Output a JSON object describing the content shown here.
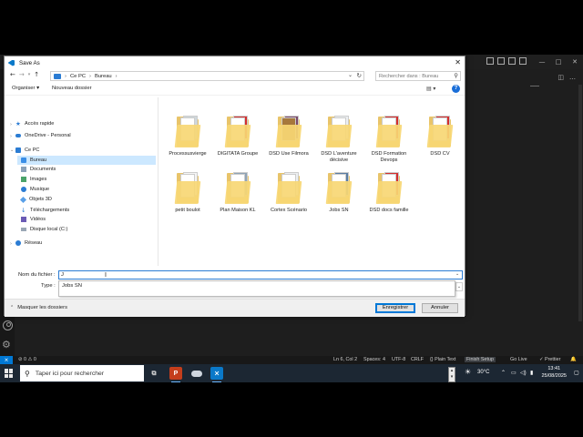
{
  "dialog": {
    "title": "Save As",
    "breadcrumb": [
      "Ce PC",
      "Bureau"
    ],
    "search_placeholder": "Rechercher dans : Bureau",
    "toolbar": {
      "organize": "Organiser ▾",
      "new_folder": "Nouveau dossier"
    },
    "sidebar": [
      {
        "label": "Accès rapide",
        "icon": "star-icon"
      },
      {
        "label": "OneDrive - Personal",
        "icon": "cloud-icon"
      },
      {
        "label": "Ce PC",
        "icon": "pc-icon"
      },
      {
        "label": "Bureau",
        "icon": "desktop-folder-icon",
        "selected": true
      },
      {
        "label": "Documents",
        "icon": "documents-icon"
      },
      {
        "label": "Images",
        "icon": "images-icon"
      },
      {
        "label": "Musique",
        "icon": "music-icon"
      },
      {
        "label": "Objets 3D",
        "icon": "objects-3d-icon"
      },
      {
        "label": "Téléchargements",
        "icon": "downloads-icon"
      },
      {
        "label": "Vidéos",
        "icon": "videos-icon"
      },
      {
        "label": "Disque local (C:)",
        "icon": "disk-icon"
      },
      {
        "label": "Réseau",
        "icon": "network-icon"
      }
    ],
    "files": [
      "Processusvierge",
      "DIGITATA Groupe",
      "DSD Use Filmora",
      "DSD L'aventure décisive",
      "DSD Formation Devops",
      "DSD CV",
      "petit boulot",
      "Plan Maison KL",
      "Cortex Scénario",
      "Jobs SN",
      "DSD docs famille"
    ],
    "filename_label": "Nom du fichier :",
    "filename_value": "J",
    "type_label": "Type :",
    "suggestion": "Jobs SN",
    "hide_folders": "Masquer les dossiers",
    "save_button": "Enregistrer",
    "cancel_button": "Annuler"
  },
  "statusbar": {
    "problems": "⊘ 0 ⚠ 0",
    "position": "Ln 6, Col 2",
    "spaces": "Spaces: 4",
    "encoding": "UTF-8",
    "eol": "CRLF",
    "language": "{} Plain Text",
    "finish_setup": "Finish Setup",
    "go_live": "Go Live",
    "prettier": "✓ Prettier"
  },
  "taskbar": {
    "search_placeholder": "Taper ici pour rechercher",
    "weather": "30°C",
    "time": "13:41",
    "date": "25/08/2025"
  },
  "colors": {
    "accent": "#0078d7",
    "selected": "#cce8ff",
    "folder": "#f7d774",
    "vs_bg": "#1e1e1e",
    "taskbar": "#1c2733"
  }
}
